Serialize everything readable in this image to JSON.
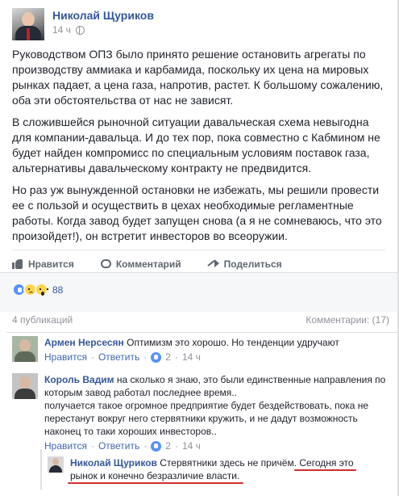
{
  "post": {
    "author": "Николай Щуриков",
    "time": "14 ч",
    "paragraphs": [
      "Руководством ОПЗ было принято решение остановить агрегаты по производству аммиака и карбамида, поскольку их цена на мировых рынках падает, а цена газа, напротив, растет. К большому сожалению, оба эти обстоятельства от нас не зависят.",
      "В сложившейся рыночной ситуации давальческая схема невыгодна для компании-давальца. И до тех пор, пока совместно с Кабмином не будет найден компромисс по специальным условиям поставок газа, альтернативы давальческому контракту не предвидится.",
      "Но раз уж вынужденной остановки не избежать, мы решили провести ее с пользой и осуществить в цехах необходимые регламентные работы. Когда завод будет запущен снова (а я не сомневаюсь, что это произойдет!), он встретит инвесторов во всеоружии."
    ]
  },
  "actions": {
    "like": "Нравится",
    "comment": "Комментарий",
    "share": "Поделиться"
  },
  "reactions": {
    "count": "88",
    "icons": [
      "like-icon",
      "sad-icon",
      "wow-icon"
    ]
  },
  "stats": {
    "publications": "4 публикаций",
    "comments": "Комментарии: (17)"
  },
  "comments": [
    {
      "author": "Армен Нерсесян",
      "text": "Оптимизм это хорошо. Но тенденции удручают",
      "like_label": "Нравится",
      "reply_label": "Ответить",
      "likes": "2",
      "time": "14 ч"
    },
    {
      "author": "Король Вадим",
      "text_lines": [
        "на сколько я знаю, это были единственные направления по",
        "которым завод работал последнее время..",
        "получается такое огромное предприятие будет бездействовать, пока не",
        "перестанут вокруг него стервятники кружить, и не дадут возможность",
        "наконец то таки хороших инвесторов.."
      ],
      "like_label": "Нравится",
      "reply_label": "Ответить",
      "likes": "2",
      "time": "14 ч"
    },
    {
      "author": "Николай Щуриков",
      "text_before": "Стервятники здесь не причём.",
      "text_highlight": "Сегодня это",
      "text_line2": "рынок и конечно безразличие власти."
    }
  ],
  "colors": {
    "link_blue": "#365899",
    "meta_gray": "#90949c",
    "highlight_red": "#d32f2f"
  }
}
